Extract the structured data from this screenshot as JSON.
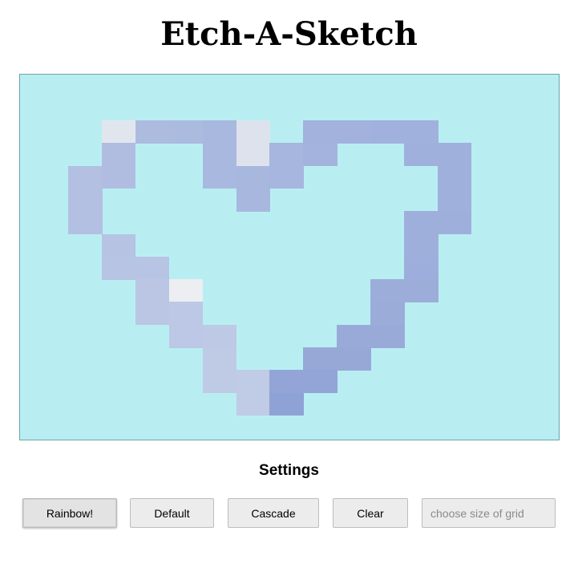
{
  "title": "Etch-A-Sketch",
  "settings_heading": "Settings",
  "buttons": {
    "rainbow": "Rainbow!",
    "default": "Default",
    "cascade": "Cascade",
    "clear": "Clear"
  },
  "size_input": {
    "placeholder": "choose size of grid",
    "value": ""
  },
  "colors": {
    "grid_background": "#b8eef2",
    "grid_border": "#6ea3a8",
    "button_background": "#ececec"
  },
  "sketch": {
    "columns": 16,
    "rows": 16,
    "cells": [
      {
        "c": 3,
        "r": 2,
        "color": "#e1e6ee"
      },
      {
        "c": 4,
        "r": 2,
        "color": "#adbbdf"
      },
      {
        "c": 5,
        "r": 2,
        "color": "#abbadf"
      },
      {
        "c": 6,
        "r": 2,
        "color": "#a9b8de"
      },
      {
        "c": 7,
        "r": 2,
        "color": "#dde2ec"
      },
      {
        "c": 9,
        "r": 2,
        "color": "#a2b2dd"
      },
      {
        "c": 10,
        "r": 2,
        "color": "#a2b2dd"
      },
      {
        "c": 11,
        "r": 2,
        "color": "#a1b1dd"
      },
      {
        "c": 12,
        "r": 2,
        "color": "#a1b1dd"
      },
      {
        "c": 3,
        "r": 3,
        "color": "#b0bde0"
      },
      {
        "c": 6,
        "r": 3,
        "color": "#a9b8de"
      },
      {
        "c": 7,
        "r": 3,
        "color": "#dde2ec"
      },
      {
        "c": 8,
        "r": 3,
        "color": "#a7b6de"
      },
      {
        "c": 9,
        "r": 3,
        "color": "#a3b3dd"
      },
      {
        "c": 12,
        "r": 3,
        "color": "#a0b0dd"
      },
      {
        "c": 13,
        "r": 3,
        "color": "#a0b0dd"
      },
      {
        "c": 2,
        "r": 4,
        "color": "#b3c0e1"
      },
      {
        "c": 3,
        "r": 4,
        "color": "#b0bde0"
      },
      {
        "c": 6,
        "r": 4,
        "color": "#a9b8de"
      },
      {
        "c": 7,
        "r": 4,
        "color": "#a8b7de"
      },
      {
        "c": 8,
        "r": 4,
        "color": "#a7b6de"
      },
      {
        "c": 13,
        "r": 4,
        "color": "#a0b0dd"
      },
      {
        "c": 2,
        "r": 5,
        "color": "#b3c0e1"
      },
      {
        "c": 7,
        "r": 5,
        "color": "#a8b7de"
      },
      {
        "c": 13,
        "r": 5,
        "color": "#a0b0dd"
      },
      {
        "c": 2,
        "r": 6,
        "color": "#b3c0e1"
      },
      {
        "c": 12,
        "r": 6,
        "color": "#9fafdc"
      },
      {
        "c": 13,
        "r": 6,
        "color": "#9fafdc"
      },
      {
        "c": 3,
        "r": 7,
        "color": "#b6c3e2"
      },
      {
        "c": 12,
        "r": 7,
        "color": "#9fafdc"
      },
      {
        "c": 3,
        "r": 8,
        "color": "#b8c4e3"
      },
      {
        "c": 4,
        "r": 8,
        "color": "#b8c4e3"
      },
      {
        "c": 12,
        "r": 8,
        "color": "#9eaedc"
      },
      {
        "c": 4,
        "r": 9,
        "color": "#bac6e4"
      },
      {
        "c": 5,
        "r": 9,
        "color": "#eceef2"
      },
      {
        "c": 11,
        "r": 9,
        "color": "#9dadd9"
      },
      {
        "c": 12,
        "r": 9,
        "color": "#9dadd9"
      },
      {
        "c": 4,
        "r": 10,
        "color": "#bac6e4"
      },
      {
        "c": 5,
        "r": 10,
        "color": "#bcc8e5"
      },
      {
        "c": 11,
        "r": 10,
        "color": "#9bacd9"
      },
      {
        "c": 5,
        "r": 11,
        "color": "#bcc8e5"
      },
      {
        "c": 6,
        "r": 11,
        "color": "#bdc9e5"
      },
      {
        "c": 10,
        "r": 11,
        "color": "#99aad8"
      },
      {
        "c": 11,
        "r": 11,
        "color": "#99aad8"
      },
      {
        "c": 6,
        "r": 12,
        "color": "#bfcae5"
      },
      {
        "c": 9,
        "r": 12,
        "color": "#97a8d7"
      },
      {
        "c": 10,
        "r": 12,
        "color": "#97a8d7"
      },
      {
        "c": 6,
        "r": 13,
        "color": "#bfcae5"
      },
      {
        "c": 7,
        "r": 13,
        "color": "#c0cbe6"
      },
      {
        "c": 8,
        "r": 13,
        "color": "#93a5d6"
      },
      {
        "c": 9,
        "r": 13,
        "color": "#93a5d6"
      },
      {
        "c": 7,
        "r": 14,
        "color": "#c0cbe6"
      },
      {
        "c": 8,
        "r": 14,
        "color": "#8fa2d5"
      }
    ]
  }
}
